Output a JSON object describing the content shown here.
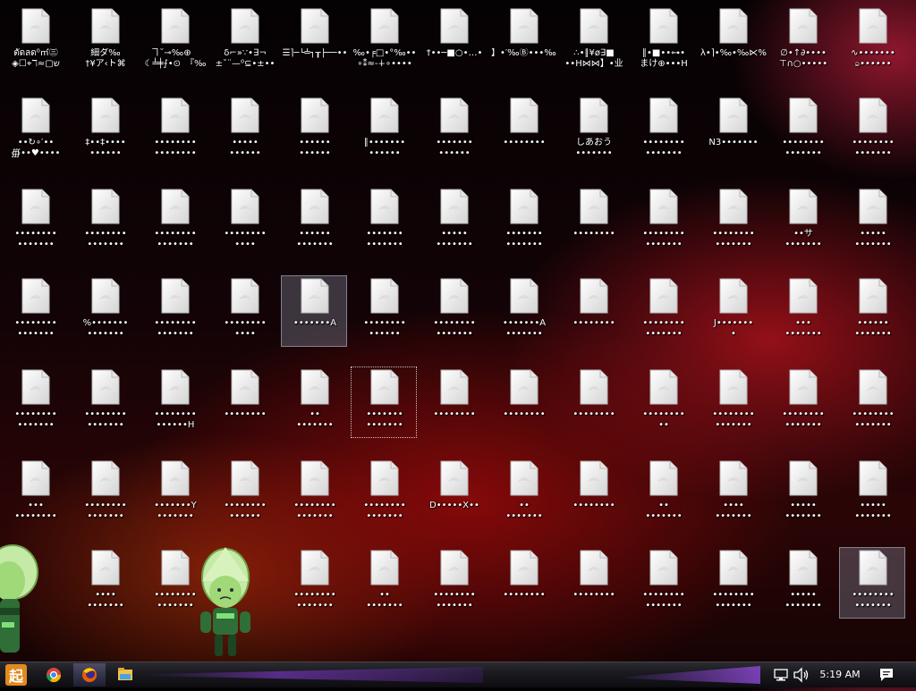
{
  "desktop": {
    "icons": [
      [
        "ตัดลด⁰㎡㊂\n◈☐⌖ℸ≈▢ש",
        "細ダ‰\n†¥ア‹ト⌘",
        "ヿ˘⊸‰⊕　\n☾╧╪⨍•⊙　『‰",
        "δ⌐»∵•∃¬\n±˘¨—⁰⊆•±••",
        "☰⌉─└╧┐┰├──••",
        "‰•╒□•°‰••\n∘⁑≈‐∔∘••••",
        "†••─■○•…•",
        "】•′‰Ⓑ•••‰•‰•",
        "∴•∥¥ø∃■\n••H⋈⋈】•业",
        "∥•■••⊶•\nまけ⊕•••H",
        "λ•⌉•‰•‰⋉‰•••",
        "∅•↑∂••••\n⊤∩○•••••",
        "∿•••••••\nခ••••••"
      ],
      [
        "••↻∘′••\n∰••♥••••",
        "‡••‡••••\n••••••",
        "••••••••\n••••••••",
        "•••••\n••••••",
        "••••••\n••••••",
        "∥•••••••\n••••••",
        "•••••••\n••••••",
        "••••••••",
        "しあおう\n•••••••",
        "••••••••\n•••••••",
        "N3•••••••",
        "••••••••\n•••••••",
        "••••••••\n•••••••"
      ],
      [
        "••••••••\n•••••••",
        "••••••••\n•••••••",
        "••••••••\n•••••••",
        "••••••••\n••••",
        "••••••\n•••••••",
        "•••••••\n•••••••",
        "•••••\n•••••••",
        "•••••••\n•••••••",
        "••••••••",
        "••••••••\n•••••••",
        "••••••••\n•••••••",
        "••サ\n•••••••",
        "•••••\n•••••••"
      ],
      [
        "••••••••\n•••••••",
        "%•••••••\n•••••••",
        "••••••••\n•••••••",
        "••••••••\n••••",
        "•••••••A",
        "••••••••\n••••••",
        "••••••••\n•••••••",
        "•••••••A\n•••••••",
        "••••••••",
        "••••••••\n•••••••",
        "J•••••••\n•",
        "•••\n•••••••",
        "••••••\n•••••••"
      ],
      [
        "••••••••\n•••••••",
        "••••••••\n•••••••",
        "••••••••\n••••••H",
        "••••••••",
        "••\n•••••••",
        "•••••••\n•••••••",
        "••••••••",
        "••••••••",
        "••••••••",
        "••••••••\n••",
        "••••••••\n•••••••",
        "••••••••\n•••••••",
        "••••••••\n•••••••"
      ],
      [
        "•••\n••••••••",
        "••••••••\n•••••••",
        "•••••••Y\n•••••••",
        "••••••••\n••••••",
        "••••••••\n•••••••",
        "••••••••\n•••••••",
        "D•••••X••",
        "••\n•••••••",
        "••••••••",
        "••\n•••••••",
        "••••\n•••••••",
        "•••••\n•••••••",
        "•••••\n•••••••"
      ],
      [
        null,
        "••••\n•••••••",
        "••••••••\n•••••••",
        null,
        "••••••••\n•••••••",
        "••\n•••••••",
        "••••••••\n•••••••",
        "••••••••",
        "••••••••",
        "••••••••\n•••••••",
        "••••••••\n•••••••",
        "•••••\n•••••••",
        "••••••••\n•••••••"
      ]
    ],
    "icon_name": "blank-file-icon",
    "selected": [
      [
        3,
        4
      ],
      [
        6,
        12
      ]
    ],
    "focused": [
      [
        4,
        5
      ]
    ]
  },
  "taskbar": {
    "start_icon": "start-logo-icon",
    "pinned": [
      {
        "name": "chrome-icon",
        "active": false
      },
      {
        "name": "firefox-icon",
        "active": true
      },
      {
        "name": "file-explorer-icon",
        "active": false
      }
    ],
    "tray": {
      "network_icon": "network-icon",
      "volume_icon": "volume-icon",
      "clock": "5:19 AM",
      "notification_icon": "action-center-icon"
    }
  },
  "colors": {
    "taskbar": "#15151a",
    "accent": "#8a4be0",
    "wallpaper_red": "#9e1212",
    "character_green": "#9fd978"
  }
}
